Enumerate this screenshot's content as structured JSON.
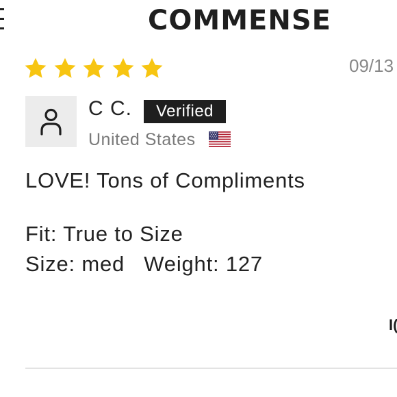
{
  "brand": {
    "name": "COMMENSE"
  },
  "review": {
    "rating": 5,
    "rating_max": 5,
    "date": "09/13",
    "reviewer": {
      "name": "C C.",
      "badge": "Verified",
      "location": "United States",
      "flag": "us-flag-icon"
    },
    "title": "LOVE! Tons of Compliments",
    "fit_line": "Fit: True to Size",
    "size_weight_line": "Size: med   Weight: 127",
    "helpful_partial": "I("
  },
  "colors": {
    "star": "#F7C511",
    "badge_bg": "#1F1F1F",
    "avatar_bg": "#ECECEC",
    "muted_text": "#7A7A7A"
  }
}
